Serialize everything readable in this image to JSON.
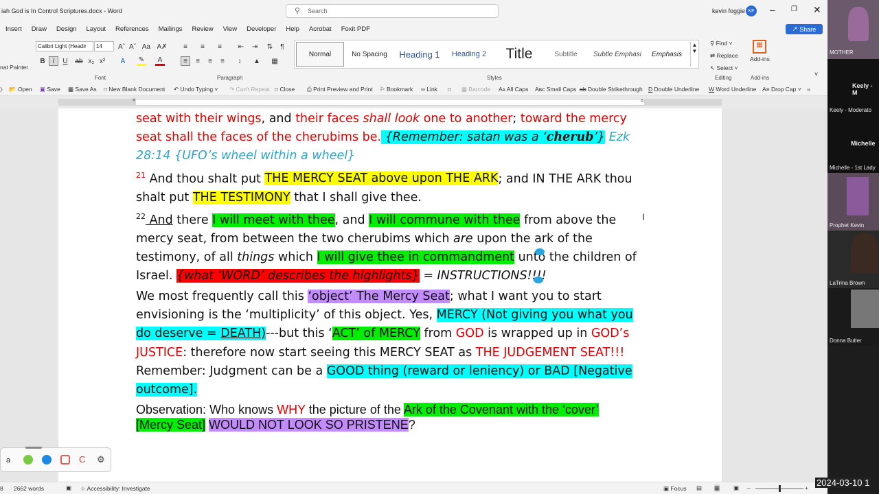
{
  "window": {
    "title": "iah God is In Control Scriptures.docx  -  Word",
    "search_placeholder": "Search",
    "user_name": "kevin foggie",
    "user_initials": "KF"
  },
  "menu": [
    "Insert",
    "Draw",
    "Design",
    "Layout",
    "References",
    "Mailings",
    "Review",
    "View",
    "Developer",
    "Help",
    "Acrobat",
    "Foxit PDF"
  ],
  "share_label": "Share",
  "ribbon": {
    "clipboard_label": "nat Painter",
    "font_name": "Calibri Light (Headir",
    "font_size": "14",
    "font_group": "Font",
    "paragraph_group": "Paragraph",
    "styles_group": "Styles",
    "editing_group": "Editing",
    "addins_group": "Add-ins",
    "styles": [
      "Normal",
      "No Spacing",
      "Heading 1",
      "Heading 2",
      "Title",
      "Subtitle",
      "Subtle Emphasi",
      "Emphasis"
    ],
    "find": "Find",
    "replace": "Replace",
    "select": "Select",
    "addins": "Add-ins"
  },
  "qat": [
    "Open",
    "Save",
    "Save As",
    "New Blank Document",
    "Undo Typing",
    "Can't Repeat",
    "Close",
    "Print Preview and Print",
    "Bookmark",
    "Link",
    "Barcode",
    "All Caps",
    "Small Caps",
    "Double Strikethrough",
    "Double Underline",
    "Word Underline",
    "Drop Cap"
  ],
  "doc": {
    "l1a": "seat with their wings",
    "l1b": ", and ",
    "l1c": "their faces ",
    "l1d": "shall look",
    "l1e": " one to another",
    "l1f": "; ",
    "l1g": "toward the mercy",
    "l2a": "seat shall the faces of the cherubims be.",
    "l2b": " {Remember: satan was a ‘",
    "l2c": "cherub",
    "l2d": "’}",
    "l2e": "  Ezk",
    "l3": "28:14 {UFO’s wheel within a wheel}",
    "v21num": "21",
    "v21a": " And thou shalt put ",
    "v21b": "THE MERCY SEAT above upon THE ARK",
    "v21c": "; and ",
    "v21d": "IN THE ARK",
    "v21e": " thou",
    "v21f": "shalt put ",
    "v21g": "THE TESTIMONY",
    "v21h": " that I shall give thee.",
    "v22num": "22",
    "v22a": " And",
    "v22b": " there ",
    "v22c": "I will meet with thee",
    "v22d": ", and ",
    "v22e": "I will commune with thee",
    "v22f": " from above the",
    "v22g": "mercy seat, from between the two cherubims which ",
    "v22h": "are",
    "v22i": " upon the ark of the",
    "v22j": "testimony, of all ",
    "v22k": "things",
    "v22l": " which ",
    "v22m": "I will give thee in commandment",
    "v22n": " unto the children of",
    "v22o": "Israel. ",
    "v22p": "{what ‘WORD’ describes the highlights}",
    "v22q": " = INSTRUCTIONS!!!!",
    "p2a": "We most frequently call this ",
    "p2b": "‘object’ The Mercy Seat",
    "p2c": "; what I want you to start",
    "p2d": "envisioning is the ‘multiplicity’ of this object.  Yes, ",
    "p2e": "MERCY (Not giving you what you",
    "p2f": "do deserve = ",
    "p2g": "DEATH)",
    "p2h": "---but this ‘",
    "p2i": "ACT’ of MERCY",
    "p2j": " from ",
    "p2k": "GOD",
    "p2l": " is wrapped up in ",
    "p2m": "GOD’s",
    "p2n": "JUSTICE",
    "p2o": ": therefore now start seeing this ",
    "p2p": "MERCY SEAT",
    "p2q": " as ",
    "p2r": "THE JUDGEMENT SEAT!!!",
    "p2s": "Remember: Judgment can be a ",
    "p2t": "GOOD",
    "p2u": " thing (",
    "p2v": "reward",
    "p2w": " or ",
    "p2x": "leniency",
    "p2y": ") or BAD [",
    "p2z": "Negative",
    "p2aa": "outcome]",
    "p2ab": ".",
    "p3a": "Observation: Who knows ",
    "p3b": "WHY",
    "p3c": " the picture of the ",
    "p3d": "Ark of the Covenant with the ‘cover’",
    "p3e": "[Mercy Seat]",
    "p3f": " ",
    "p3g": "WOULD NOT LOOK SO PRISTENE",
    "p3h": "?"
  },
  "status": {
    "page": "8",
    "words": "2662 words",
    "accessibility": "Accessibility: Investigate",
    "focus": "Focus"
  },
  "participants": [
    {
      "name": "MOTHER"
    },
    {
      "name": "Keely - M"
    },
    {
      "name": "Keely - Moderato"
    },
    {
      "name": "Michelle"
    },
    {
      "name": "Michelle - 1st Lady"
    },
    {
      "name": "Prophet Kevin"
    },
    {
      "name": "LaTrina Brown"
    },
    {
      "name": "Donna Butler"
    }
  ],
  "timestamp": "2024-03-10 1"
}
